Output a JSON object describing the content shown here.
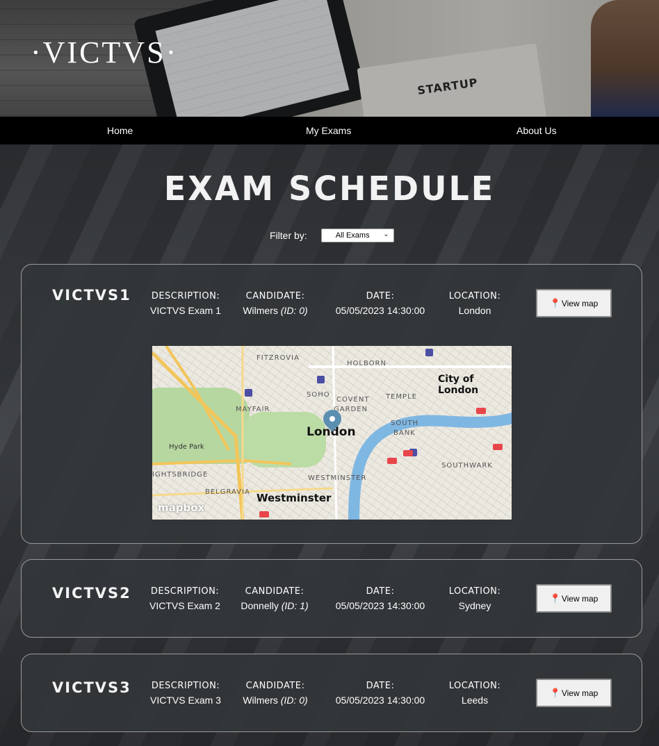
{
  "brand": {
    "logo_text": "·VICTVS·",
    "banner_book_text": "STARTUP"
  },
  "nav": {
    "items": [
      {
        "label": "Home"
      },
      {
        "label": "My Exams"
      },
      {
        "label": "About Us"
      }
    ]
  },
  "page": {
    "title": "EXAM SCHEDULE"
  },
  "filter": {
    "label": "Filter by:",
    "selected": "All Exams"
  },
  "labels": {
    "description": "DESCRIPTION:",
    "candidate": "CANDIDATE:",
    "date": "DATE:",
    "location": "LOCATION:",
    "view_map": "View map"
  },
  "exams": [
    {
      "code": "VICTVS1",
      "description": "VICTVS Exam 1",
      "candidate_name": "Wilmers",
      "candidate_id": "(ID: 0)",
      "date": "05/05/2023 14:30:00",
      "location": "London",
      "map_open": true
    },
    {
      "code": "VICTVS2",
      "description": "VICTVS Exam 2",
      "candidate_name": "Donnelly",
      "candidate_id": "(ID: 1)",
      "date": "05/05/2023 14:30:00",
      "location": "Sydney",
      "map_open": false
    },
    {
      "code": "VICTVS3",
      "description": "VICTVS Exam 3",
      "candidate_name": "Wilmers",
      "candidate_id": "(ID: 0)",
      "date": "05/05/2023 14:30:00",
      "location": "Leeds",
      "map_open": false
    }
  ],
  "map": {
    "labels": {
      "fitzrovia": "FITZROVIA",
      "holborn": "HOLBORN",
      "city": "City of London",
      "soho": "SOHO",
      "covent": "COVENT",
      "garden": "GARDEN",
      "temple": "TEMPLE",
      "mayfair": "MAYFAIR",
      "london": "London",
      "south": "SOUTH",
      "bank": "BANK",
      "hydepark": "Hyde Park",
      "southwark": "SOUTHWARK",
      "knightsbridge": "IGHTSBRIDGE",
      "westminster_caps": "WESTMINSTER",
      "belgravia": "BELGRAVIA",
      "westminster": "Westminster"
    },
    "attribution": "mapbox",
    "info_icon": "i"
  },
  "icons": {
    "pin": "map-pin-icon",
    "chevron": "chevron-down-icon"
  },
  "colors": {
    "nav_bg": "#000000",
    "card_bg": "#32363a",
    "pin": "#d62828",
    "river": "#7fb7e3"
  }
}
